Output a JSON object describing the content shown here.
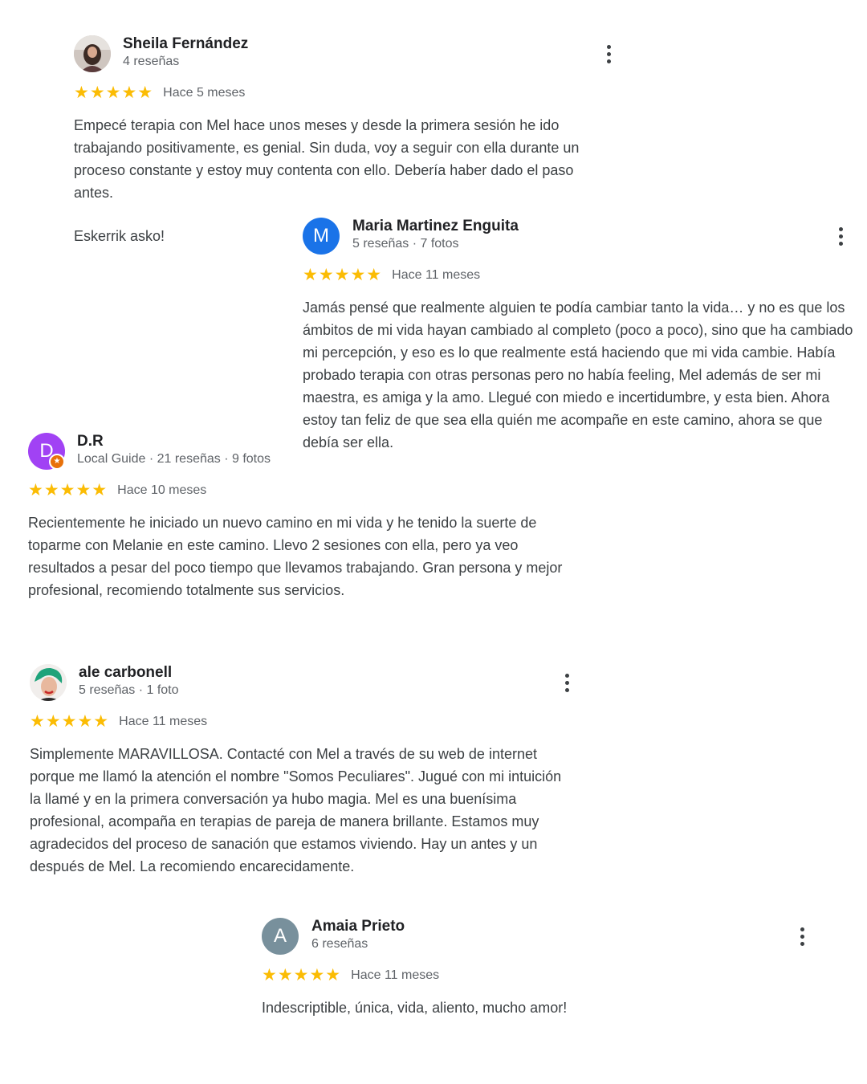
{
  "reviews": [
    {
      "name": "Sheila Fernández",
      "meta": "4 reseñas",
      "stars": "★★★★★",
      "time": "Hace 5 meses",
      "text": "Empecé terapia con Mel hace unos meses y desde la primera sesión he ido trabajando positivamente, es genial. Sin duda, voy a seguir con ella durante un proceso constante y estoy muy contenta con ello. Debería haber dado el paso antes.",
      "text2": "Eskerrik asko!",
      "avatar_icon": "person-photo-icon"
    },
    {
      "name": "Maria Martinez Enguita",
      "meta": "5 reseñas · 7 fotos",
      "stars": "★★★★★",
      "time": "Hace 11 meses",
      "text": "Jamás pensé que realmente alguien te podía cambiar tanto la vida… y no es que los ámbitos de mi vida hayan cambiado al completo (poco a poco), sino que ha cambiado mi percepción, y eso es lo que realmente está haciendo que mi vida cambie. Había probado terapia con otras personas pero no había feeling, Mel además de ser mi maestra, es amiga y la amo. Llegué con miedo e incertidumbre, y esta bien. Ahora estoy tan feliz de que sea ella quién me acompañe en este camino, ahora se que debía ser ella.",
      "avatar_letter": "M",
      "avatar_color": "#1a73e8"
    },
    {
      "name": "D.R",
      "meta": "Local Guide · 21 reseñas · 9 fotos",
      "stars": "★★★★★",
      "time": "Hace 10 meses",
      "text": "Recientemente he iniciado un nuevo camino en mi vida y he tenido la suerte de toparme con Melanie en este camino. Llevo 2 sesiones con ella, pero ya veo resultados a pesar del poco tiempo que llevamos trabajando. Gran persona y mejor profesional, recomiendo totalmente sus servicios.",
      "avatar_letter": "D",
      "avatar_color": "#a142f4",
      "badge": "★"
    },
    {
      "name": "ale carbonell",
      "meta": "5 reseñas · 1 foto",
      "stars": "★★★★★",
      "time": "Hace 11 meses",
      "text": "Simplemente MARAVILLOSA. Contacté con Mel a través de su web de internet porque me llamó la atención el nombre \"Somos Peculiares\". Jugué con mi intuición la llamé y en la primera conversación ya hubo magia. Mel es una buenísima profesional, acompaña en terapias de pareja de manera brillante. Estamos muy agradecidos del proceso de sanación que estamos viviendo. Hay un antes y un después de Mel. La recomiendo encarecidamente.",
      "avatar_icon": "person-photo-icon"
    },
    {
      "name": "Amaia Prieto",
      "meta": "6 reseñas",
      "stars": "★★★★★",
      "time": "Hace 11 meses",
      "text": "Indescriptible, única, vida, aliento, mucho amor!",
      "avatar_letter": "A",
      "avatar_color": "#78909c"
    }
  ],
  "colors": {
    "star": "#fbbc04",
    "meta": "#5f6368",
    "text": "#3c4043"
  },
  "more_icon": "more-vert-icon"
}
